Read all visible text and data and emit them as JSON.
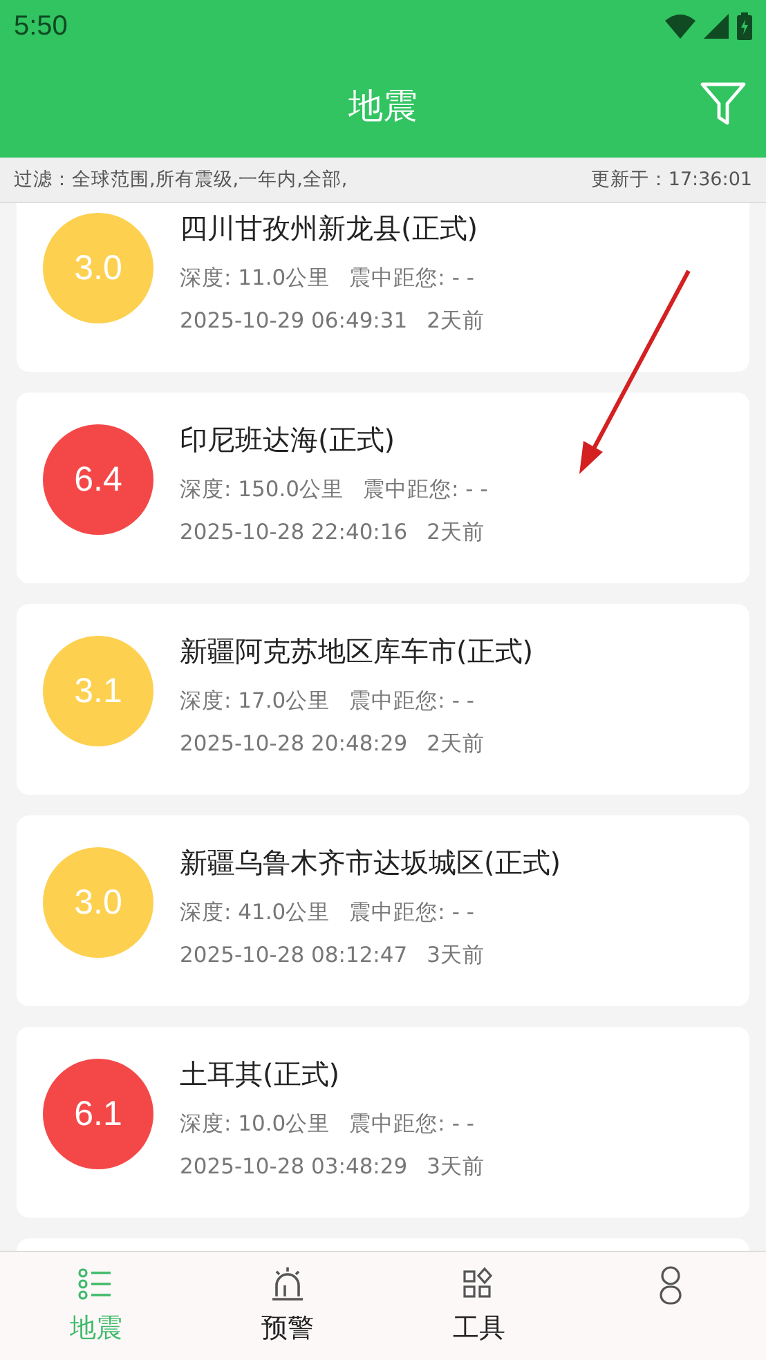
{
  "status_bar": {
    "time": "5:50"
  },
  "app_bar": {
    "title": "地震"
  },
  "filter_bar": {
    "filter": "过滤：全球范围,所有震级,一年内,全部,",
    "updated": "更新于：17:36:01"
  },
  "quakes": [
    {
      "magnitude": "3.0",
      "color": "#fdd04f",
      "place": "四川甘孜州新龙县(正式)",
      "depth": "深度: 11.0公里",
      "distance": "震中距您: - -",
      "time": "2025-10-29 06:49:31",
      "ago": "2天前"
    },
    {
      "magnitude": "6.4",
      "color": "#f44848",
      "place": "印尼班达海(正式)",
      "depth": "深度: 150.0公里",
      "distance": "震中距您: - -",
      "time": "2025-10-28 22:40:16",
      "ago": "2天前"
    },
    {
      "magnitude": "3.1",
      "color": "#fdd04f",
      "place": "新疆阿克苏地区库车市(正式)",
      "depth": "深度: 17.0公里",
      "distance": "震中距您: - -",
      "time": "2025-10-28 20:48:29",
      "ago": "2天前"
    },
    {
      "magnitude": "3.0",
      "color": "#fdd04f",
      "place": "新疆乌鲁木齐市达坂城区(正式)",
      "depth": "深度: 41.0公里",
      "distance": "震中距您: - -",
      "time": "2025-10-28 08:12:47",
      "ago": "3天前"
    },
    {
      "magnitude": "6.1",
      "color": "#f44848",
      "place": "土耳其(正式)",
      "depth": "深度: 10.0公里",
      "distance": "震中距您: - -",
      "time": "2025-10-28 03:48:29",
      "ago": "3天前"
    }
  ],
  "nav": [
    {
      "kind": "list",
      "label": "地震",
      "selected": true
    },
    {
      "kind": "alarm",
      "label": "预警",
      "selected": false
    },
    {
      "kind": "apps",
      "label": "工具",
      "selected": false
    },
    {
      "kind": "person",
      "selected": false
    }
  ]
}
